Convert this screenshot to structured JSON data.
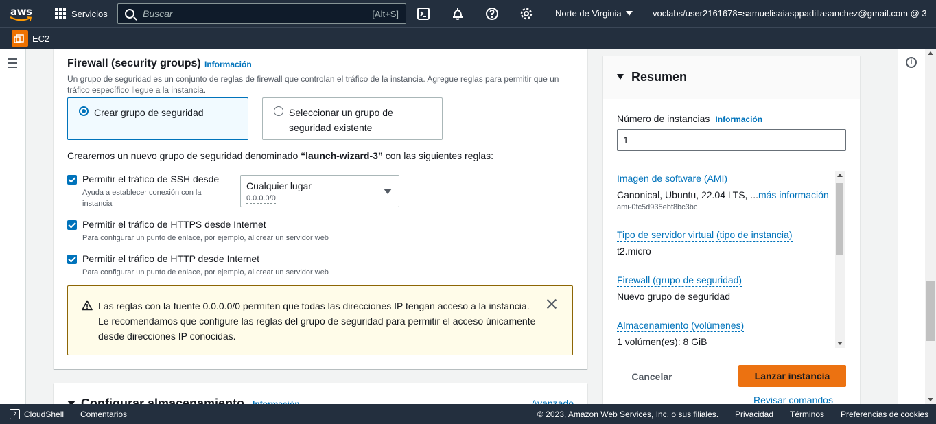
{
  "topnav": {
    "logo": "aws",
    "services_label": "Servicios",
    "search_placeholder": "Buscar",
    "search_shortcut": "[Alt+S]",
    "region": "Norte de Virginia",
    "account": "voclabs/user2161678=samuelisaiasppadillasanchez@gmail.com @ 3..."
  },
  "subnav": {
    "service": "EC2"
  },
  "firewall": {
    "title": "Firewall (security groups)",
    "info": "Información",
    "description": "Un grupo de seguridad es un conjunto de reglas de firewall que controlan el tráfico de la instancia. Agregue reglas para permitir que un tráfico específico llegue a la instancia.",
    "option_create": "Crear grupo de seguridad",
    "option_select": "Seleccionar un grupo de seguridad existente",
    "note_prefix": "Crearemos un nuevo grupo de seguridad denominado ",
    "note_name": "“launch-wizard-3”",
    "note_suffix": " con las siguientes reglas:",
    "rules": [
      {
        "label": "Permitir el tráfico de SSH desde",
        "desc": "Ayuda a establecer conexión con la\ninstancia",
        "checked": true
      },
      {
        "label": "Permitir el tráfico de HTTPS desde Internet",
        "desc": "Para configurar un punto de enlace, por ejemplo, al crear un servidor web",
        "checked": true
      },
      {
        "label": "Permitir el tráfico de HTTP desde Internet",
        "desc": "Para configurar un punto de enlace, por ejemplo, al crear un servidor web",
        "checked": true
      }
    ],
    "ssh_source": {
      "value": "Cualquier lugar",
      "cidr": "0.0.0.0/0"
    },
    "warning_line1": "Las reglas con la fuente 0.0.0.0/0 permiten que todas las direcciones IP tengan acceso a la instancia.",
    "warning_line2": "Le recomendamos que configure las reglas del grupo de seguridad para permitir el acceso únicamente desde direcciones IP conocidas."
  },
  "storage_section": {
    "title": "Configurar almacenamiento",
    "info": "Información",
    "advanced": "Avanzado"
  },
  "summary": {
    "title": "Resumen",
    "num_instances_label": "Número de instancias",
    "info": "Información",
    "num_instances_value": "1",
    "ami_label": "Imagen de software (AMI)",
    "ami_value": "Canonical, Ubuntu, 22.04 LTS, ...",
    "ami_more": "más información",
    "ami_id": "ami-0fc5d935ebf8bc3bc",
    "instance_type_label": "Tipo de servidor virtual (tipo de instancia)",
    "instance_type_value": "t2.micro",
    "firewall_label": "Firewall (grupo de seguridad)",
    "firewall_value": "Nuevo grupo de seguridad",
    "storage_label": "Almacenamiento (volúmenes)",
    "storage_value": "1 volúmen(es): 8 GiB",
    "cancel": "Cancelar",
    "launch": "Lanzar instancia",
    "review": "Revisar comandos"
  },
  "footer": {
    "cloudshell": "CloudShell",
    "feedback": "Comentarios",
    "copyright": "© 2023, Amazon Web Services, Inc. o sus filiales.",
    "privacy": "Privacidad",
    "terms": "Términos",
    "cookies": "Preferencias de cookies"
  },
  "colors": {
    "nav_bg": "#232f3e",
    "link": "#0073bb",
    "launch_button": "#ec7211",
    "warning_bg": "#fffce9"
  }
}
